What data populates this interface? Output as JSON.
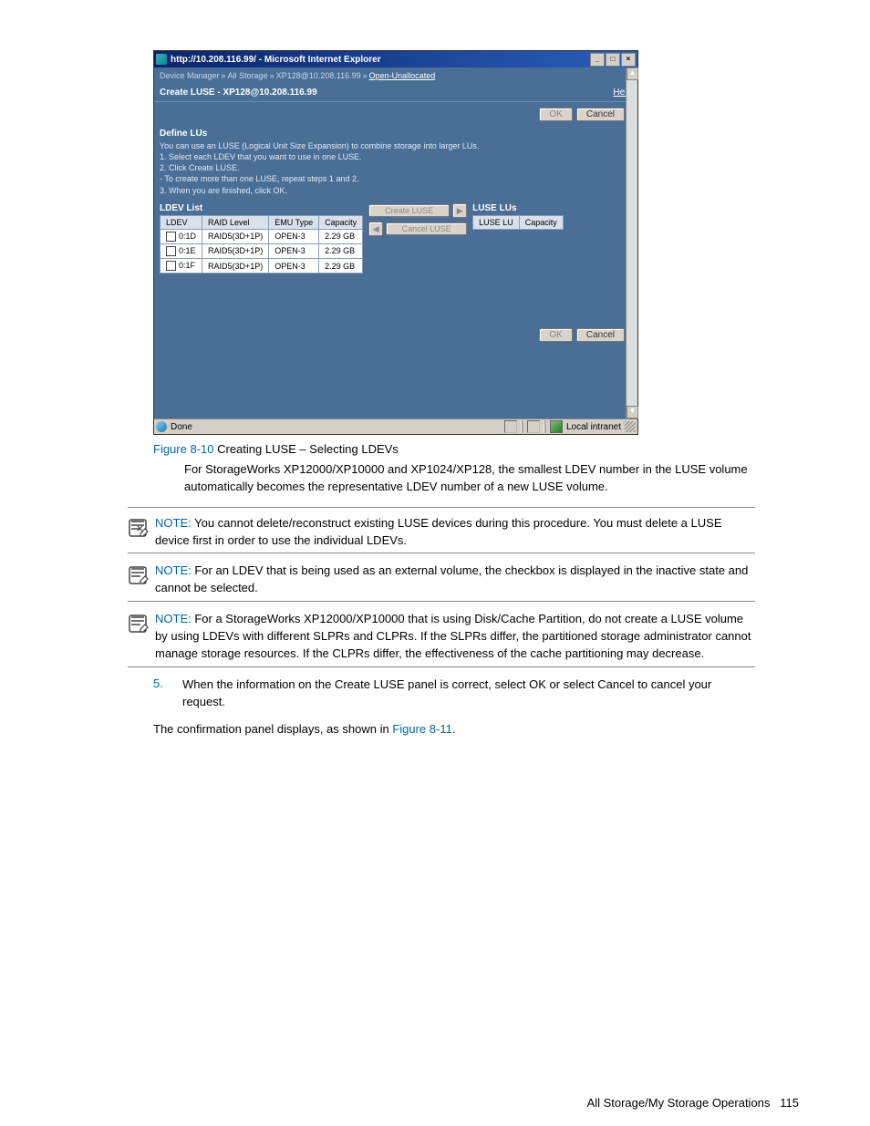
{
  "window": {
    "title": "http://10.208.116.99/ - Microsoft Internet Explorer",
    "breadcrumb": [
      "Device Manager",
      "All Storage",
      "XP128@10.208.116.99",
      "Open-Unallocated"
    ],
    "subheader": "Create LUSE - XP128@10.208.116.99",
    "help": "Help",
    "ok": "OK",
    "cancel": "Cancel",
    "section_title": "Define LUs",
    "desc_line1": "You can use an LUSE (Logical Unit Size Expansion) to combine storage into larger LUs.",
    "desc_line2": "1. Select each LDEV that you want to use in one LUSE.",
    "desc_line3": "2. Click Create LUSE.",
    "desc_line4": "- To create more than one LUSE, repeat steps 1 and 2.",
    "desc_line5": "3. When you are finished, click OK.",
    "ldev_list_title": "LDEV List",
    "luse_lus_title": "LUSE LUs",
    "create_luse": "Create LUSE",
    "cancel_luse": "Cancel LUSE",
    "status_done": "Done",
    "status_zone": "Local intranet"
  },
  "ldev_table": {
    "headers": [
      "LDEV",
      "RAID Level",
      "EMU Type",
      "Capacity"
    ],
    "rows": [
      {
        "ldev": "0:1D",
        "raid": "RAID5(3D+1P)",
        "emu": "OPEN-3",
        "cap": "2.29 GB"
      },
      {
        "ldev": "0:1E",
        "raid": "RAID5(3D+1P)",
        "emu": "OPEN-3",
        "cap": "2.29 GB"
      },
      {
        "ldev": "0:1F",
        "raid": "RAID5(3D+1P)",
        "emu": "OPEN-3",
        "cap": "2.29 GB"
      }
    ]
  },
  "luse_table": {
    "headers": [
      "LUSE LU",
      "Capacity"
    ]
  },
  "caption": {
    "label": "Figure 8-10",
    "text": " Creating LUSE – Selecting LDEVs"
  },
  "para1": "For StorageWorks XP12000/XP10000 and XP1024/XP128, the smallest LDEV number in the LUSE volume automatically becomes the representative LDEV number of a new LUSE volume.",
  "notes": [
    {
      "label": "NOTE:",
      "text": "  You cannot delete/reconstruct existing LUSE devices during this procedure. You must delete a LUSE device first in order to use the individual LDEVs."
    },
    {
      "label": "NOTE:",
      "text": "  For an LDEV that is being used as an external volume, the checkbox is displayed in the inactive state and cannot be selected."
    },
    {
      "label": "NOTE:",
      "text": "  For a StorageWorks XP12000/XP10000 that is using Disk/Cache Partition, do not create a LUSE volume by using LDEVs with different SLPRs and CLPRs. If the SLPRs differ, the partitioned storage administrator cannot manage storage resources. If the CLPRs differ, the effectiveness of the cache partitioning may decrease."
    }
  ],
  "step": {
    "num": "5.",
    "text": "When the information on the Create LUSE panel is correct, select OK or select Cancel to cancel your request."
  },
  "confirm_text_a": "The confirmation panel displays, as shown in ",
  "confirm_text_link": "Figure 8-11",
  "confirm_text_b": ".",
  "footer": {
    "section": "All Storage/My Storage Operations",
    "page": "115"
  }
}
